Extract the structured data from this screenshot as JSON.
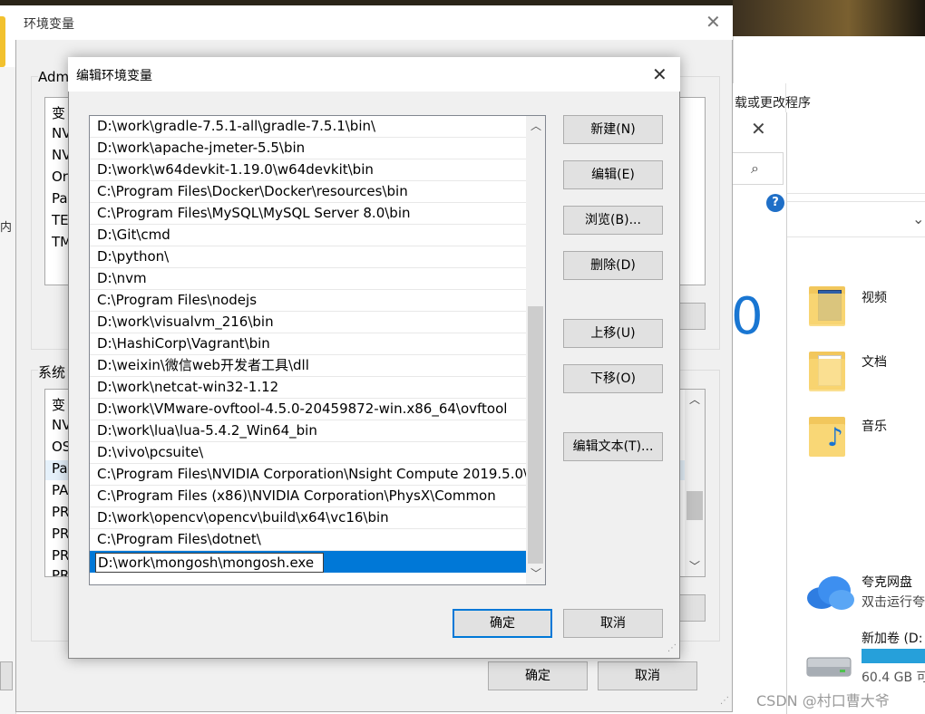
{
  "env_dialog": {
    "title": "环境变量",
    "user_group_label": "Adm",
    "user_rows": [
      "变",
      "NV",
      "NV",
      "Or",
      "Pa",
      "TE",
      "TM"
    ],
    "system_group_label": "系统",
    "system_rows": [
      "变",
      "NV",
      "OS",
      "Pa",
      "PA",
      "PR",
      "PR",
      "PR",
      "PR"
    ],
    "ok_label": "确定",
    "cancel_label": "取消"
  },
  "edit_dialog": {
    "title": "编辑环境变量",
    "paths": [
      "D:\\work\\gradle-7.5.1-all\\gradle-7.5.1\\bin\\",
      "D:\\work\\apache-jmeter-5.5\\bin",
      "D:\\work\\w64devkit-1.19.0\\w64devkit\\bin",
      "C:\\Program Files\\Docker\\Docker\\resources\\bin",
      "C:\\Program Files\\MySQL\\MySQL Server 8.0\\bin",
      "D:\\Git\\cmd",
      "D:\\python\\",
      "D:\\nvm",
      "C:\\Program Files\\nodejs",
      "D:\\work\\visualvm_216\\bin",
      "D:\\HashiCorp\\Vagrant\\bin",
      "D:\\weixin\\微信web开发者工具\\dll",
      "D:\\work\\netcat-win32-1.12",
      "D:\\work\\VMware-ovftool-4.5.0-20459872-win.x86_64\\ovftool",
      "D:\\work\\lua\\lua-5.4.2_Win64_bin",
      "D:\\vivo\\pcsuite\\",
      "C:\\Program Files\\NVIDIA Corporation\\Nsight Compute 2019.5.0\\",
      "C:\\Program Files (x86)\\NVIDIA Corporation\\PhysX\\Common",
      "D:\\work\\opencv\\opencv\\build\\x64\\vc16\\bin",
      "C:\\Program Files\\dotnet\\"
    ],
    "editing_value": "D:\\work\\mongosh\\mongosh.exe",
    "buttons": {
      "new": "新建(N)",
      "edit": "编辑(E)",
      "browse": "浏览(B)...",
      "delete": "删除(D)",
      "move_up": "上移(U)",
      "move_down": "下移(O)",
      "edit_text": "编辑文本(T)...",
      "ok": "确定",
      "cancel": "取消"
    }
  },
  "explorer": {
    "ribbon_text": "载或更改程序",
    "big_digit": "0",
    "left_sliver_text": "内",
    "quick_access": [
      {
        "label": "视频",
        "icon": "video-folder-icon"
      },
      {
        "label": "文档",
        "icon": "documents-folder-icon"
      },
      {
        "label": "音乐",
        "icon": "music-folder-icon"
      }
    ],
    "cloud": {
      "title": "夸克网盘",
      "subtitle": "双击运行夸"
    },
    "drive": {
      "title": "新加卷 (D:",
      "free": "60.4 GB 可"
    }
  },
  "watermark": "CSDN @村口曹大爷",
  "colors": {
    "accent": "#0078d7",
    "button_face": "#e1e1e1",
    "dialog_face": "#f0f0f0",
    "help_blue": "#1f6fc7"
  }
}
